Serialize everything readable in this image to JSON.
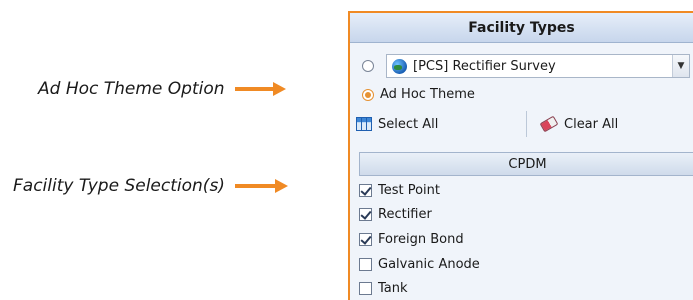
{
  "callouts": {
    "ad_hoc": "Ad Hoc Theme Option",
    "facility": "Facility Type Selection(s)"
  },
  "panel": {
    "title": "Facility Types",
    "survey_option": {
      "selected": false
    },
    "survey_combo": {
      "value": "[PCS] Rectifier Survey",
      "icon": "globe-icon"
    },
    "ad_hoc_option": {
      "label": "Ad Hoc Theme",
      "selected": true
    },
    "toolbar": {
      "select_all": "Select All",
      "clear_all": "Clear All"
    },
    "group": {
      "title": "CPDM",
      "items": [
        {
          "label": "Test Point",
          "checked": true
        },
        {
          "label": "Rectifier",
          "checked": true
        },
        {
          "label": "Foreign Bond",
          "checked": true
        },
        {
          "label": "Galvanic Anode",
          "checked": false
        },
        {
          "label": "Tank",
          "checked": false
        }
      ]
    }
  },
  "colors": {
    "accent": "#f08a24",
    "panel_bg": "#f0f4fa"
  }
}
